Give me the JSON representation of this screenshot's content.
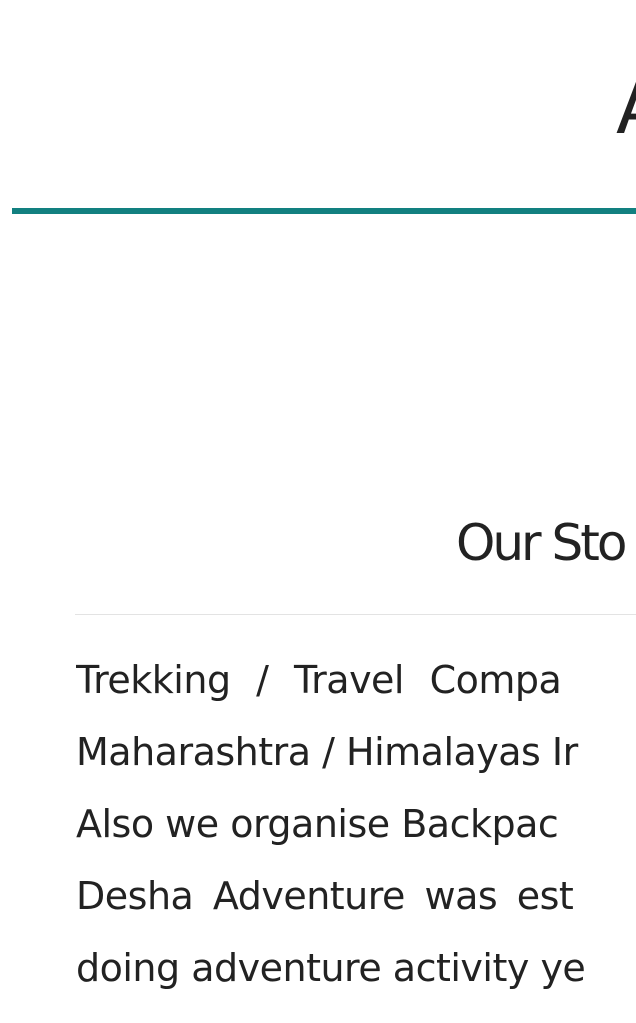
{
  "header": {
    "title": "A"
  },
  "story": {
    "title": "Our Sto",
    "lines": [
      "Trekking / Travel Compa",
      "Maharashtra / Himalayas Ir",
      "Also we organise Backpac",
      "Desha Adventure was est",
      "doing adventure activity ye"
    ]
  },
  "colors": {
    "accent": "#128080",
    "text": "#222222",
    "rule": "#e3e3e3",
    "background": "#ffffff"
  }
}
